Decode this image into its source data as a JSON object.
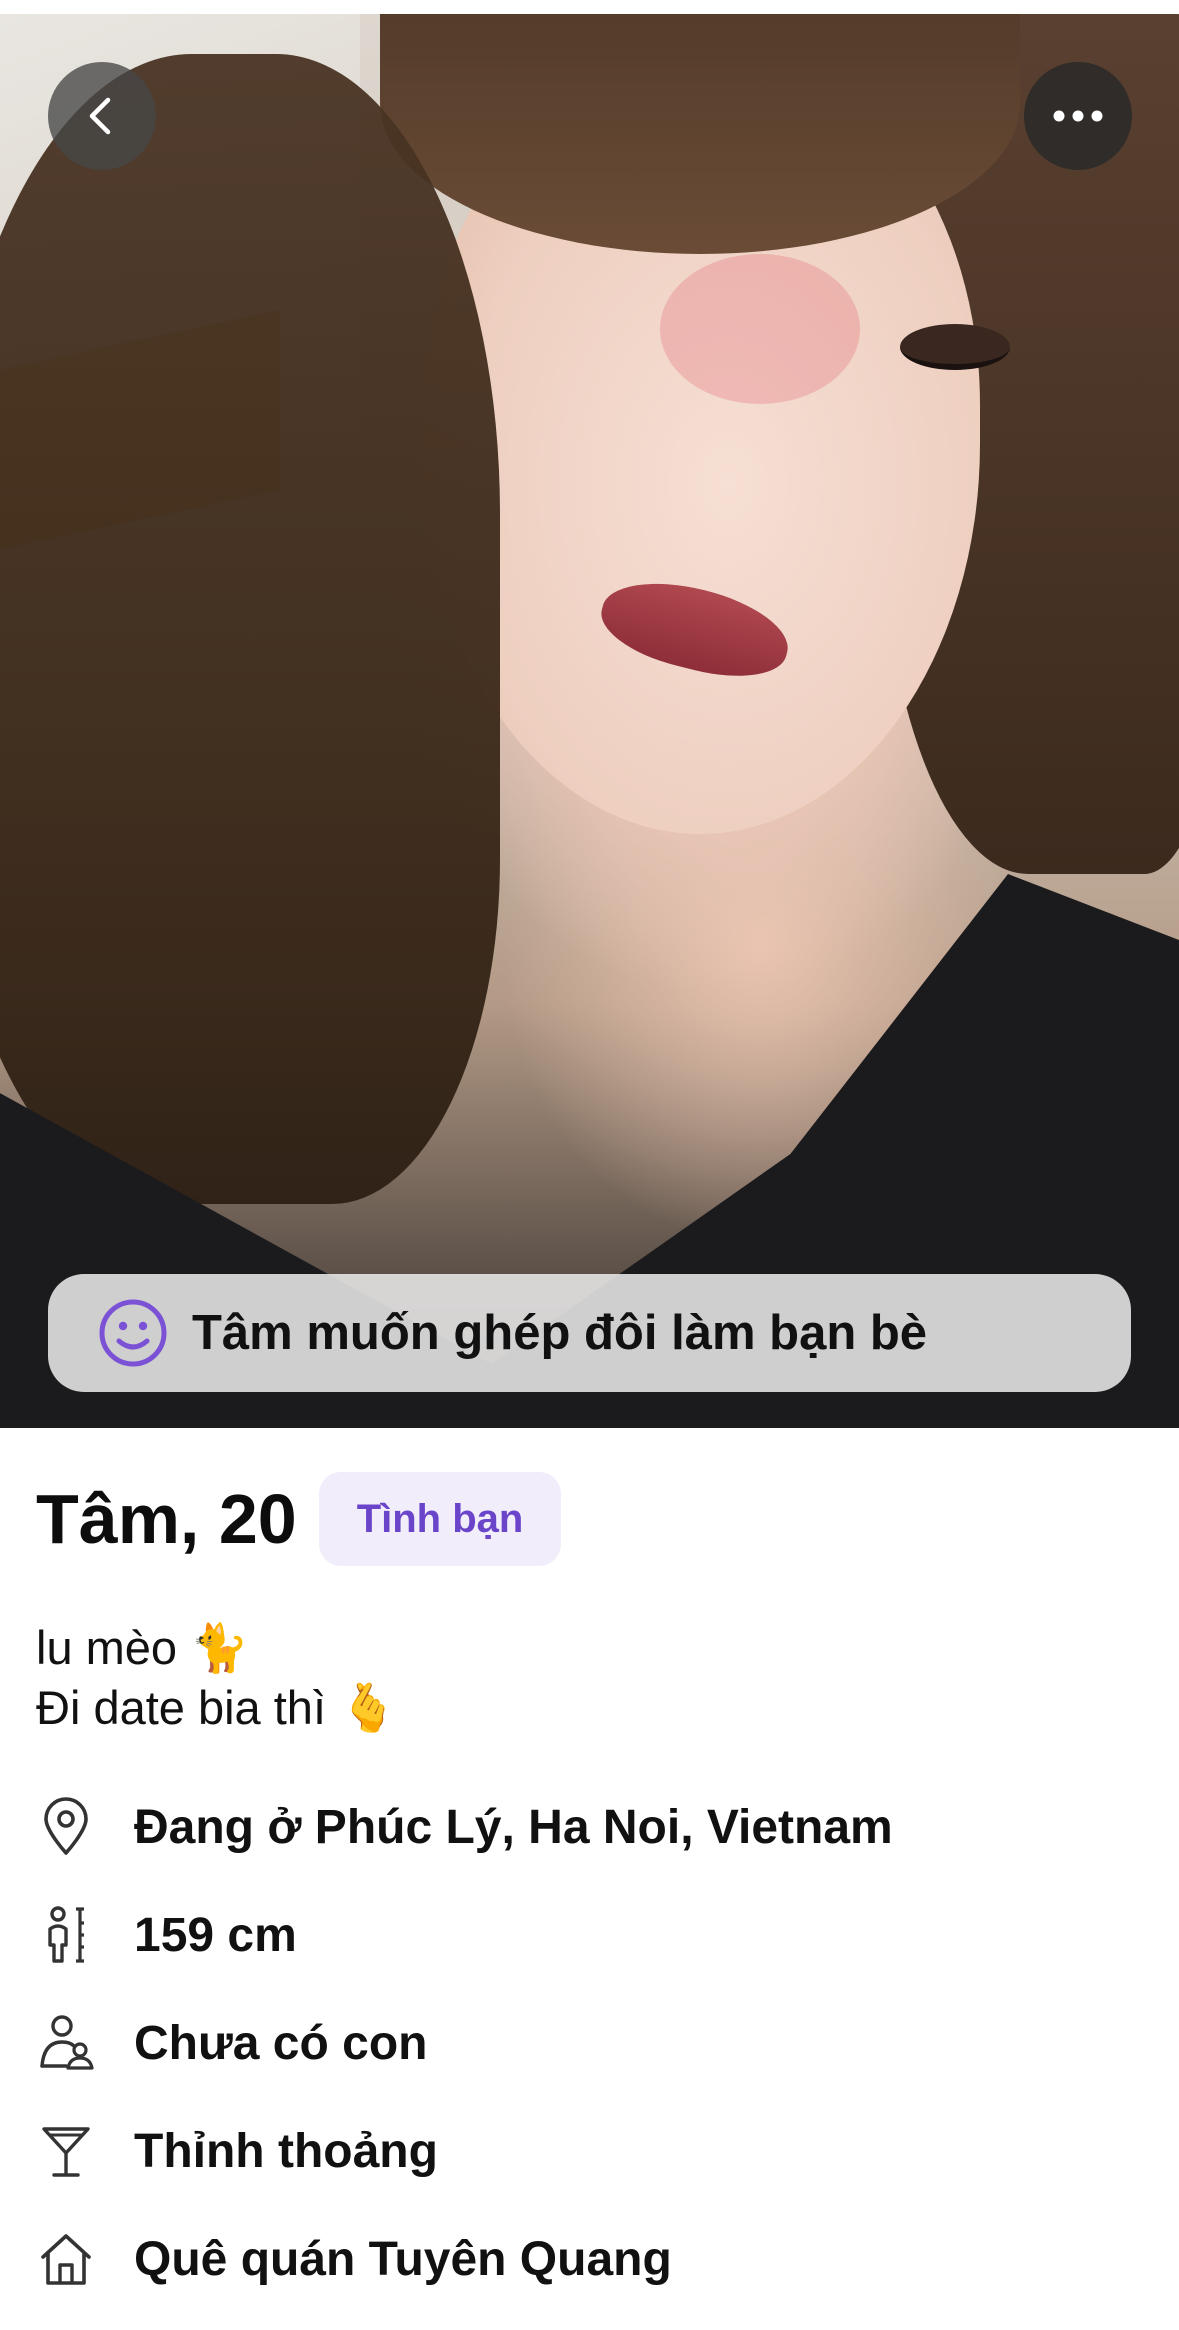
{
  "photo": {
    "alt": "profile-photo"
  },
  "nav": {
    "back_icon": "chevron-left-icon",
    "more_icon": "ellipsis-icon"
  },
  "match_banner": {
    "icon": "smile-icon",
    "text": "Tâm muốn ghép đôi làm bạn bè"
  },
  "profile": {
    "name_age": "Tâm, 20",
    "badge": "Tình bạn",
    "bio_lines": [
      "lu mèo 🐈",
      "Đi date bia thì 🫰"
    ],
    "details": [
      {
        "icon": "location-pin-icon",
        "label": "Đang ở Phúc Lý, Ha Noi, Vietnam"
      },
      {
        "icon": "height-icon",
        "label": "159 cm"
      },
      {
        "icon": "children-icon",
        "label": "Chưa có con"
      },
      {
        "icon": "cocktail-icon",
        "label": "Thỉnh thoảng"
      },
      {
        "icon": "home-icon",
        "label": "Quê quán Tuyên Quang"
      }
    ]
  },
  "colors": {
    "badge_bg": "#f1edfb",
    "accent": "#6a45c9"
  }
}
